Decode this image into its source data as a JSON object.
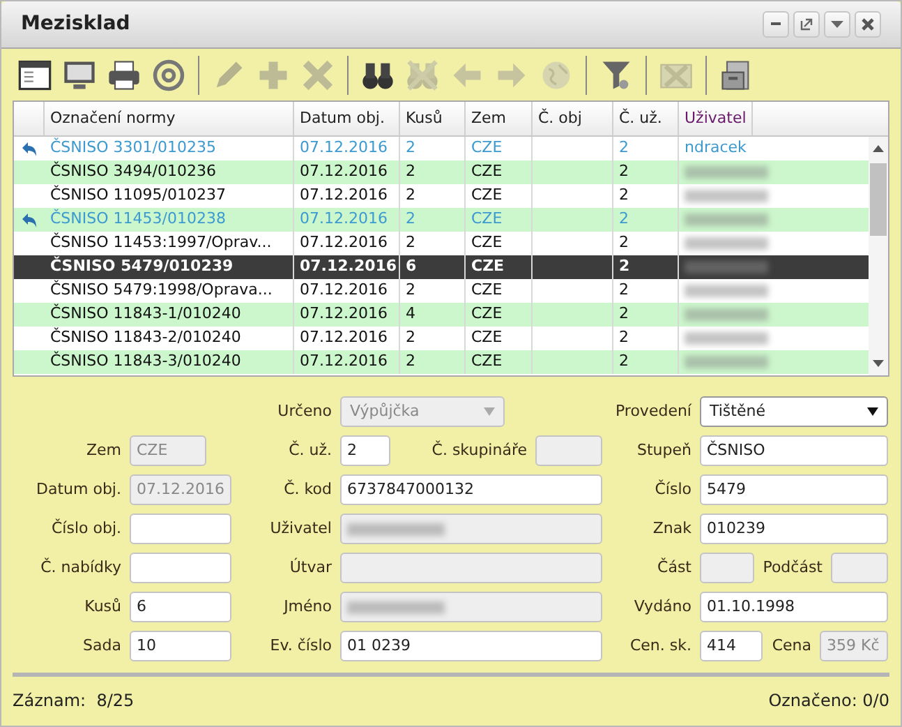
{
  "window": {
    "title": "Mezisklad",
    "controls": [
      {
        "kind": "minimize"
      },
      {
        "kind": "popout"
      },
      {
        "kind": "menu"
      },
      {
        "kind": "close"
      }
    ]
  },
  "toolbar": {
    "groups": [
      [
        {
          "kind": "window",
          "disabled": false
        },
        {
          "kind": "monitor",
          "disabled": false
        },
        {
          "kind": "printer",
          "disabled": false
        },
        {
          "kind": "at",
          "disabled": false
        }
      ],
      [
        {
          "kind": "pencil",
          "disabled": true
        },
        {
          "kind": "plus",
          "disabled": true
        },
        {
          "kind": "cross",
          "disabled": true
        }
      ],
      [
        {
          "kind": "binoculars",
          "disabled": false
        },
        {
          "kind": "binoculars-off",
          "disabled": true
        },
        {
          "kind": "arrow-left",
          "disabled": true
        },
        {
          "kind": "arrow-right",
          "disabled": true
        },
        {
          "kind": "globe",
          "disabled": true
        }
      ],
      [
        {
          "kind": "filter",
          "disabled": false
        }
      ],
      [
        {
          "kind": "mail-off",
          "disabled": true
        }
      ],
      [
        {
          "kind": "cabinet",
          "disabled": false
        }
      ]
    ]
  },
  "table": {
    "columns": [
      {
        "label": "Označení normy",
        "sorted": false
      },
      {
        "label": "Datum obj.",
        "sorted": false
      },
      {
        "label": "Kusů",
        "sorted": false
      },
      {
        "label": "Zem",
        "sorted": false
      },
      {
        "label": "Č. obj",
        "sorted": false
      },
      {
        "label": "Č. už.",
        "sorted": false
      },
      {
        "label": "Uživatel",
        "sorted": true
      }
    ],
    "rows": [
      {
        "returned": true,
        "selected": false,
        "cells": [
          "ČSNISO 3301/010235",
          "07.12.2016",
          "2",
          "CZE",
          "",
          "2"
        ],
        "user": "ndracek",
        "blurred": false
      },
      {
        "returned": false,
        "selected": false,
        "cells": [
          "ČSNISO 3494/010236",
          "07.12.2016",
          "2",
          "CZE",
          "",
          "2"
        ],
        "blurred": true
      },
      {
        "returned": false,
        "selected": false,
        "cells": [
          "ČSNISO 11095/010237",
          "07.12.2016",
          "2",
          "CZE",
          "",
          "2"
        ],
        "blurred": true
      },
      {
        "returned": true,
        "selected": false,
        "cells": [
          "ČSNISO 11453/010238",
          "07.12.2016",
          "2",
          "CZE",
          "",
          "2"
        ],
        "blurred": true
      },
      {
        "returned": false,
        "selected": false,
        "cells": [
          "ČSNISO 11453:1997/Oprav...",
          "07.12.2016",
          "2",
          "CZE",
          "",
          "2"
        ],
        "blurred": true
      },
      {
        "returned": false,
        "selected": true,
        "cells": [
          "ČSNISO 5479/010239",
          "07.12.2016",
          "6",
          "CZE",
          "",
          "2"
        ],
        "blurred": true
      },
      {
        "returned": false,
        "selected": false,
        "cells": [
          "ČSNISO 5479:1998/Oprava...",
          "07.12.2016",
          "2",
          "CZE",
          "",
          "2"
        ],
        "blurred": true
      },
      {
        "returned": false,
        "selected": false,
        "cells": [
          "ČSNISO 11843-1/010240",
          "07.12.2016",
          "4",
          "CZE",
          "",
          "2"
        ],
        "blurred": true
      },
      {
        "returned": false,
        "selected": false,
        "cells": [
          "ČSNISO 11843-2/010240",
          "07.12.2016",
          "2",
          "CZE",
          "",
          "2"
        ],
        "blurred": true
      },
      {
        "returned": false,
        "selected": false,
        "cells": [
          "ČSNISO 11843-3/010240",
          "07.12.2016",
          "2",
          "CZE",
          "",
          "2"
        ],
        "blurred": true
      }
    ]
  },
  "form": {
    "rows": [
      [
        "",
        "",
        {
          "kind": "label",
          "text": "Určeno"
        },
        {
          "kind": "select",
          "value": "Výpůjčka",
          "disabled": true
        },
        "",
        "",
        {
          "kind": "label",
          "text": "Provedení"
        },
        {
          "kind": "select",
          "value": "Tištěné",
          "disabled": false
        }
      ],
      [
        {
          "kind": "label",
          "text": "Zem"
        },
        {
          "kind": "field",
          "value": "CZE",
          "disabled": true
        },
        {
          "kind": "label",
          "text": "Č. už."
        },
        {
          "kind": "field",
          "value": "2",
          "disabled": false
        },
        {
          "kind": "label",
          "text": "Č. skupináře"
        },
        {
          "kind": "field",
          "disabled": true
        },
        {
          "kind": "label",
          "text": "Stupeň"
        },
        {
          "kind": "field",
          "value": "ČSNISO",
          "disabled": false
        }
      ],
      [
        {
          "kind": "label",
          "text": "Datum obj."
        },
        {
          "kind": "field",
          "value": "07.12.2016",
          "disabled": true
        },
        {
          "kind": "label",
          "text": "Č. kod"
        },
        {
          "kind": "field",
          "value": "6737847000132",
          "disabled": false
        },
        {
          "kind": "label",
          "text": "Číslo"
        },
        {
          "kind": "field",
          "value": "5479",
          "disabled": false
        }
      ],
      [
        {
          "kind": "label",
          "text": "Číslo obj."
        },
        {
          "kind": "field",
          "disabled": false
        },
        {
          "kind": "label",
          "text": "Uživatel"
        },
        {
          "kind": "field",
          "disabled": true,
          "blurred": true
        },
        {
          "kind": "label",
          "text": "Znak"
        },
        {
          "kind": "field",
          "value": "010239",
          "disabled": false
        }
      ],
      [
        {
          "kind": "label",
          "text": "Č. nabídky"
        },
        {
          "kind": "field",
          "disabled": false
        },
        {
          "kind": "label",
          "text": "Útvar"
        },
        {
          "kind": "field",
          "disabled": true
        },
        {
          "kind": "label",
          "text": "Část"
        },
        {
          "kind": "field",
          "disabled": true
        },
        {
          "kind": "label",
          "text": "Podčást"
        },
        {
          "kind": "field",
          "disabled": true
        }
      ],
      [
        {
          "kind": "label",
          "text": "Kusů"
        },
        {
          "kind": "field",
          "value": "6",
          "disabled": false
        },
        {
          "kind": "label",
          "text": "Jméno"
        },
        {
          "kind": "field",
          "disabled": true,
          "blurred": true
        },
        {
          "kind": "label",
          "text": "Vydáno"
        },
        {
          "kind": "field",
          "value": "01.10.1998",
          "disabled": false
        }
      ],
      [
        {
          "kind": "label",
          "text": "Sada"
        },
        {
          "kind": "field",
          "value": "10",
          "disabled": false
        },
        {
          "kind": "label",
          "text": "Ev. číslo"
        },
        {
          "kind": "field",
          "value": "01 0239",
          "disabled": false
        },
        {
          "kind": "label",
          "text": "Cen. sk."
        },
        {
          "kind": "field",
          "value": "414",
          "disabled": false
        },
        {
          "kind": "label",
          "text": "Cena"
        },
        {
          "kind": "field",
          "value": "359 Kč",
          "disabled": true
        }
      ]
    ]
  },
  "status_bar": {
    "record": "Záznam:  8/25",
    "marked": "Označeno: 0/0"
  }
}
